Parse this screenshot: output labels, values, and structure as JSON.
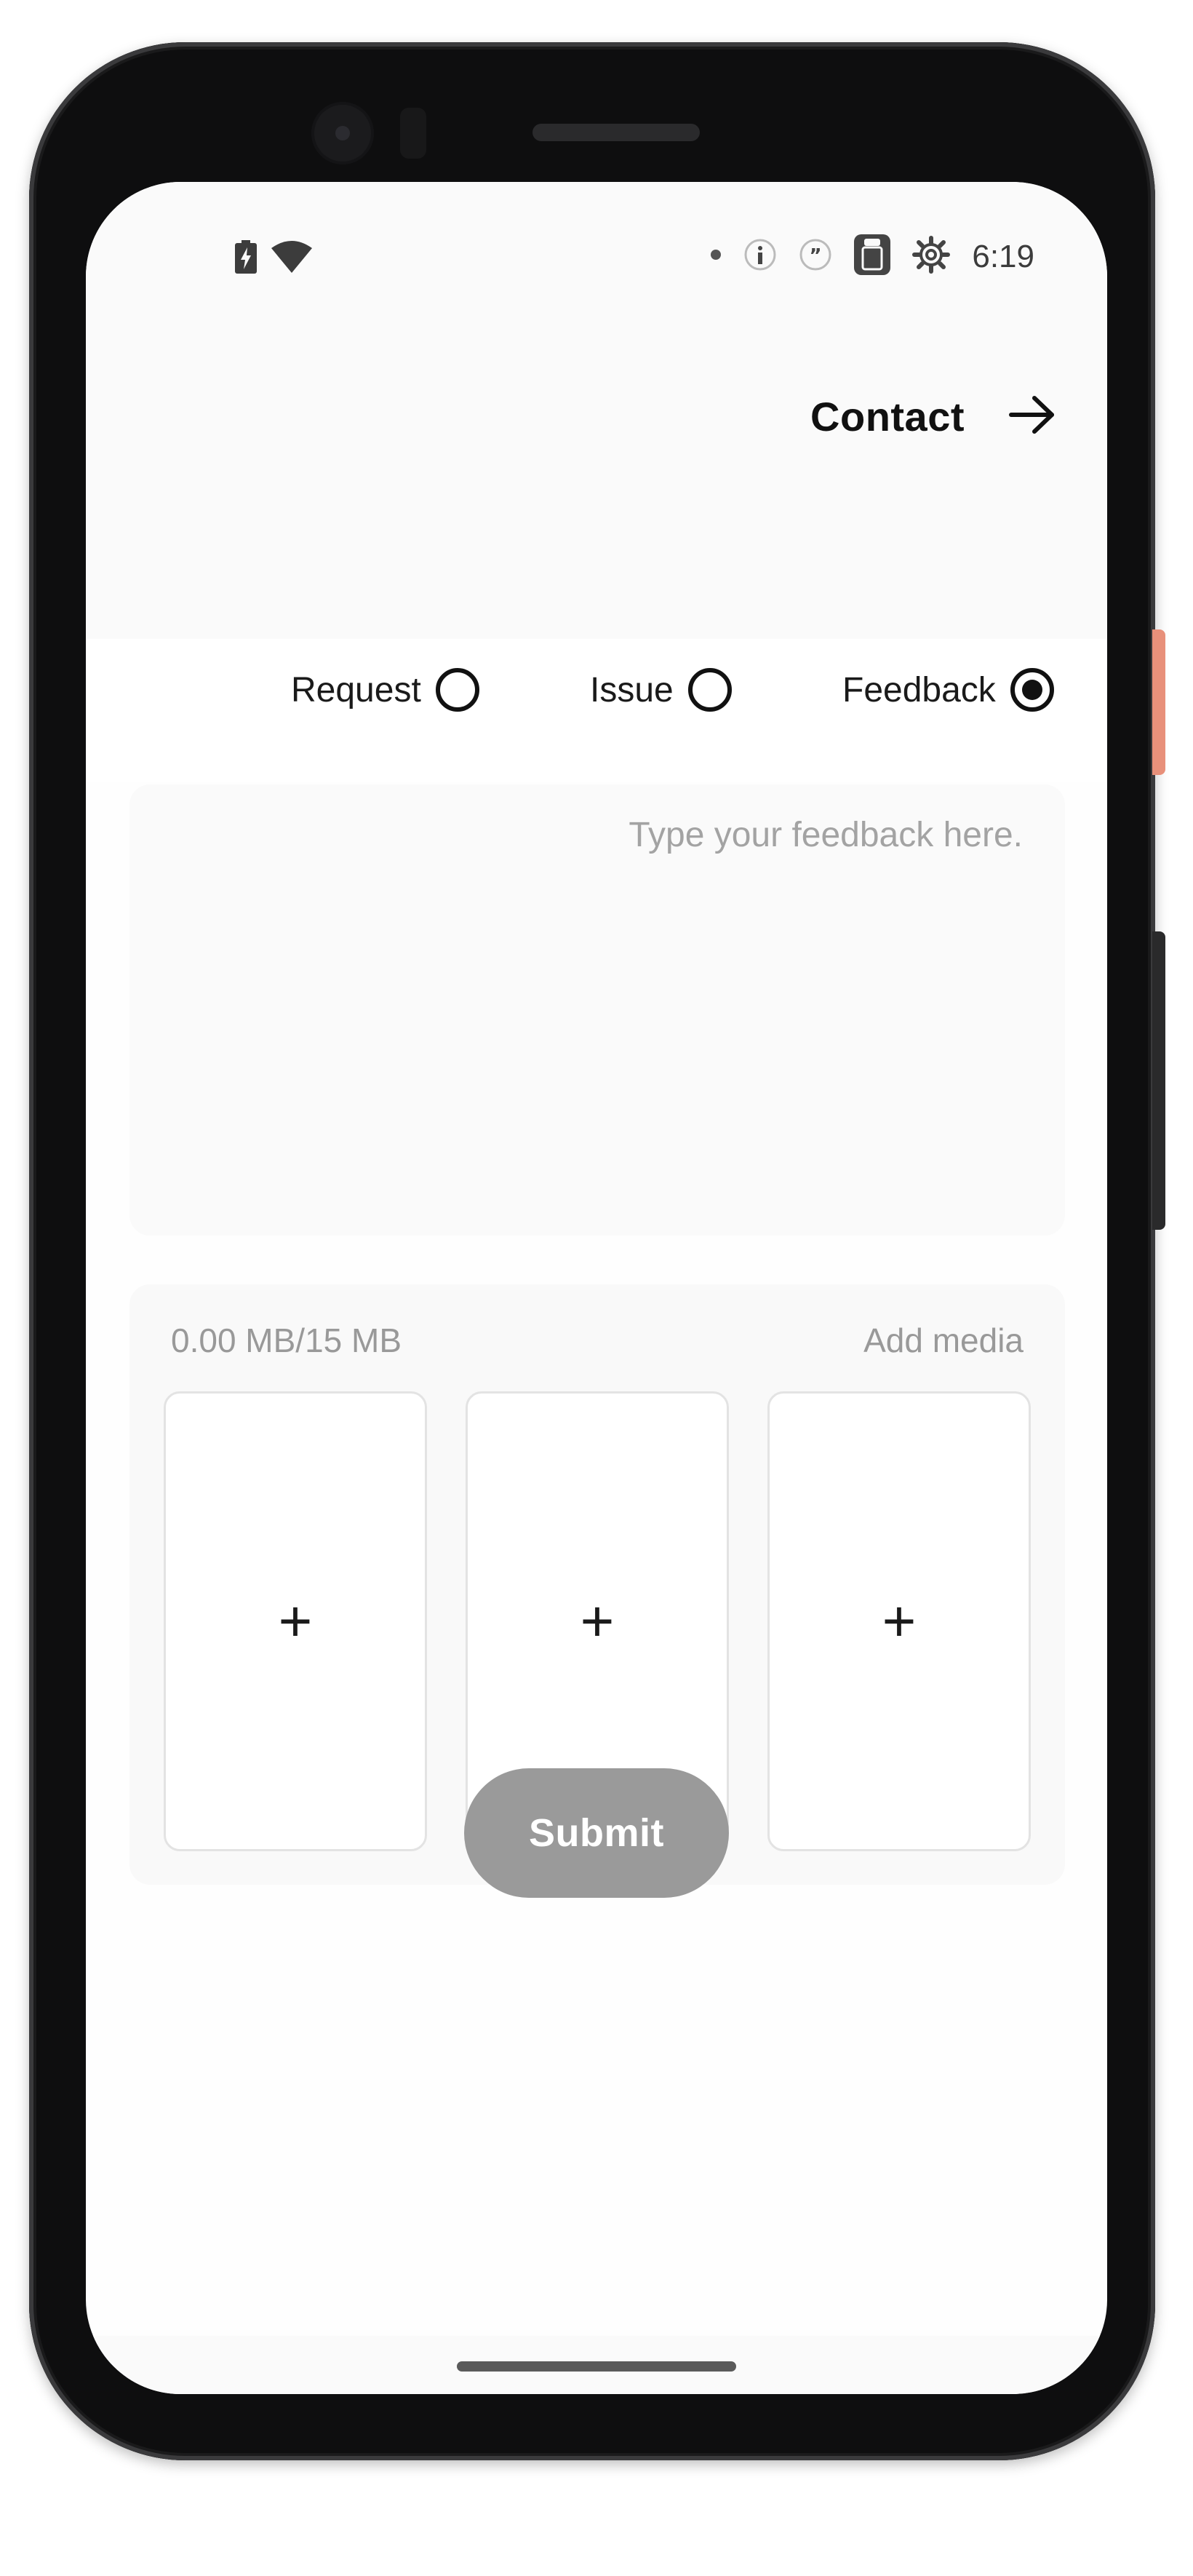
{
  "status_bar": {
    "time": "6:19",
    "left_icons": [
      "battery-charging-icon",
      "wifi-icon"
    ],
    "right_icons": [
      "dot-icon",
      "info-icon",
      "quote-icon",
      "clipboard-icon",
      "gear-icon"
    ]
  },
  "app_bar": {
    "title": "Contact",
    "action_icon": "arrow-right-icon"
  },
  "type_options": [
    {
      "label": "Request",
      "selected": false
    },
    {
      "label": "Issue",
      "selected": false
    },
    {
      "label": "Feedback",
      "selected": true
    }
  ],
  "feedback": {
    "placeholder": "Type your feedback here.",
    "value": ""
  },
  "media": {
    "size_text": "0.00 MB/15 MB",
    "add_label": "Add media",
    "slots": [
      {
        "symbol": "+"
      },
      {
        "symbol": "+"
      },
      {
        "symbol": "+"
      }
    ]
  },
  "submit": {
    "label": "Submit"
  },
  "colors": {
    "accent": "#111111",
    "submit_bg": "#9a9a9a",
    "muted_text": "#999999",
    "panel_bg": "#fafafa"
  }
}
